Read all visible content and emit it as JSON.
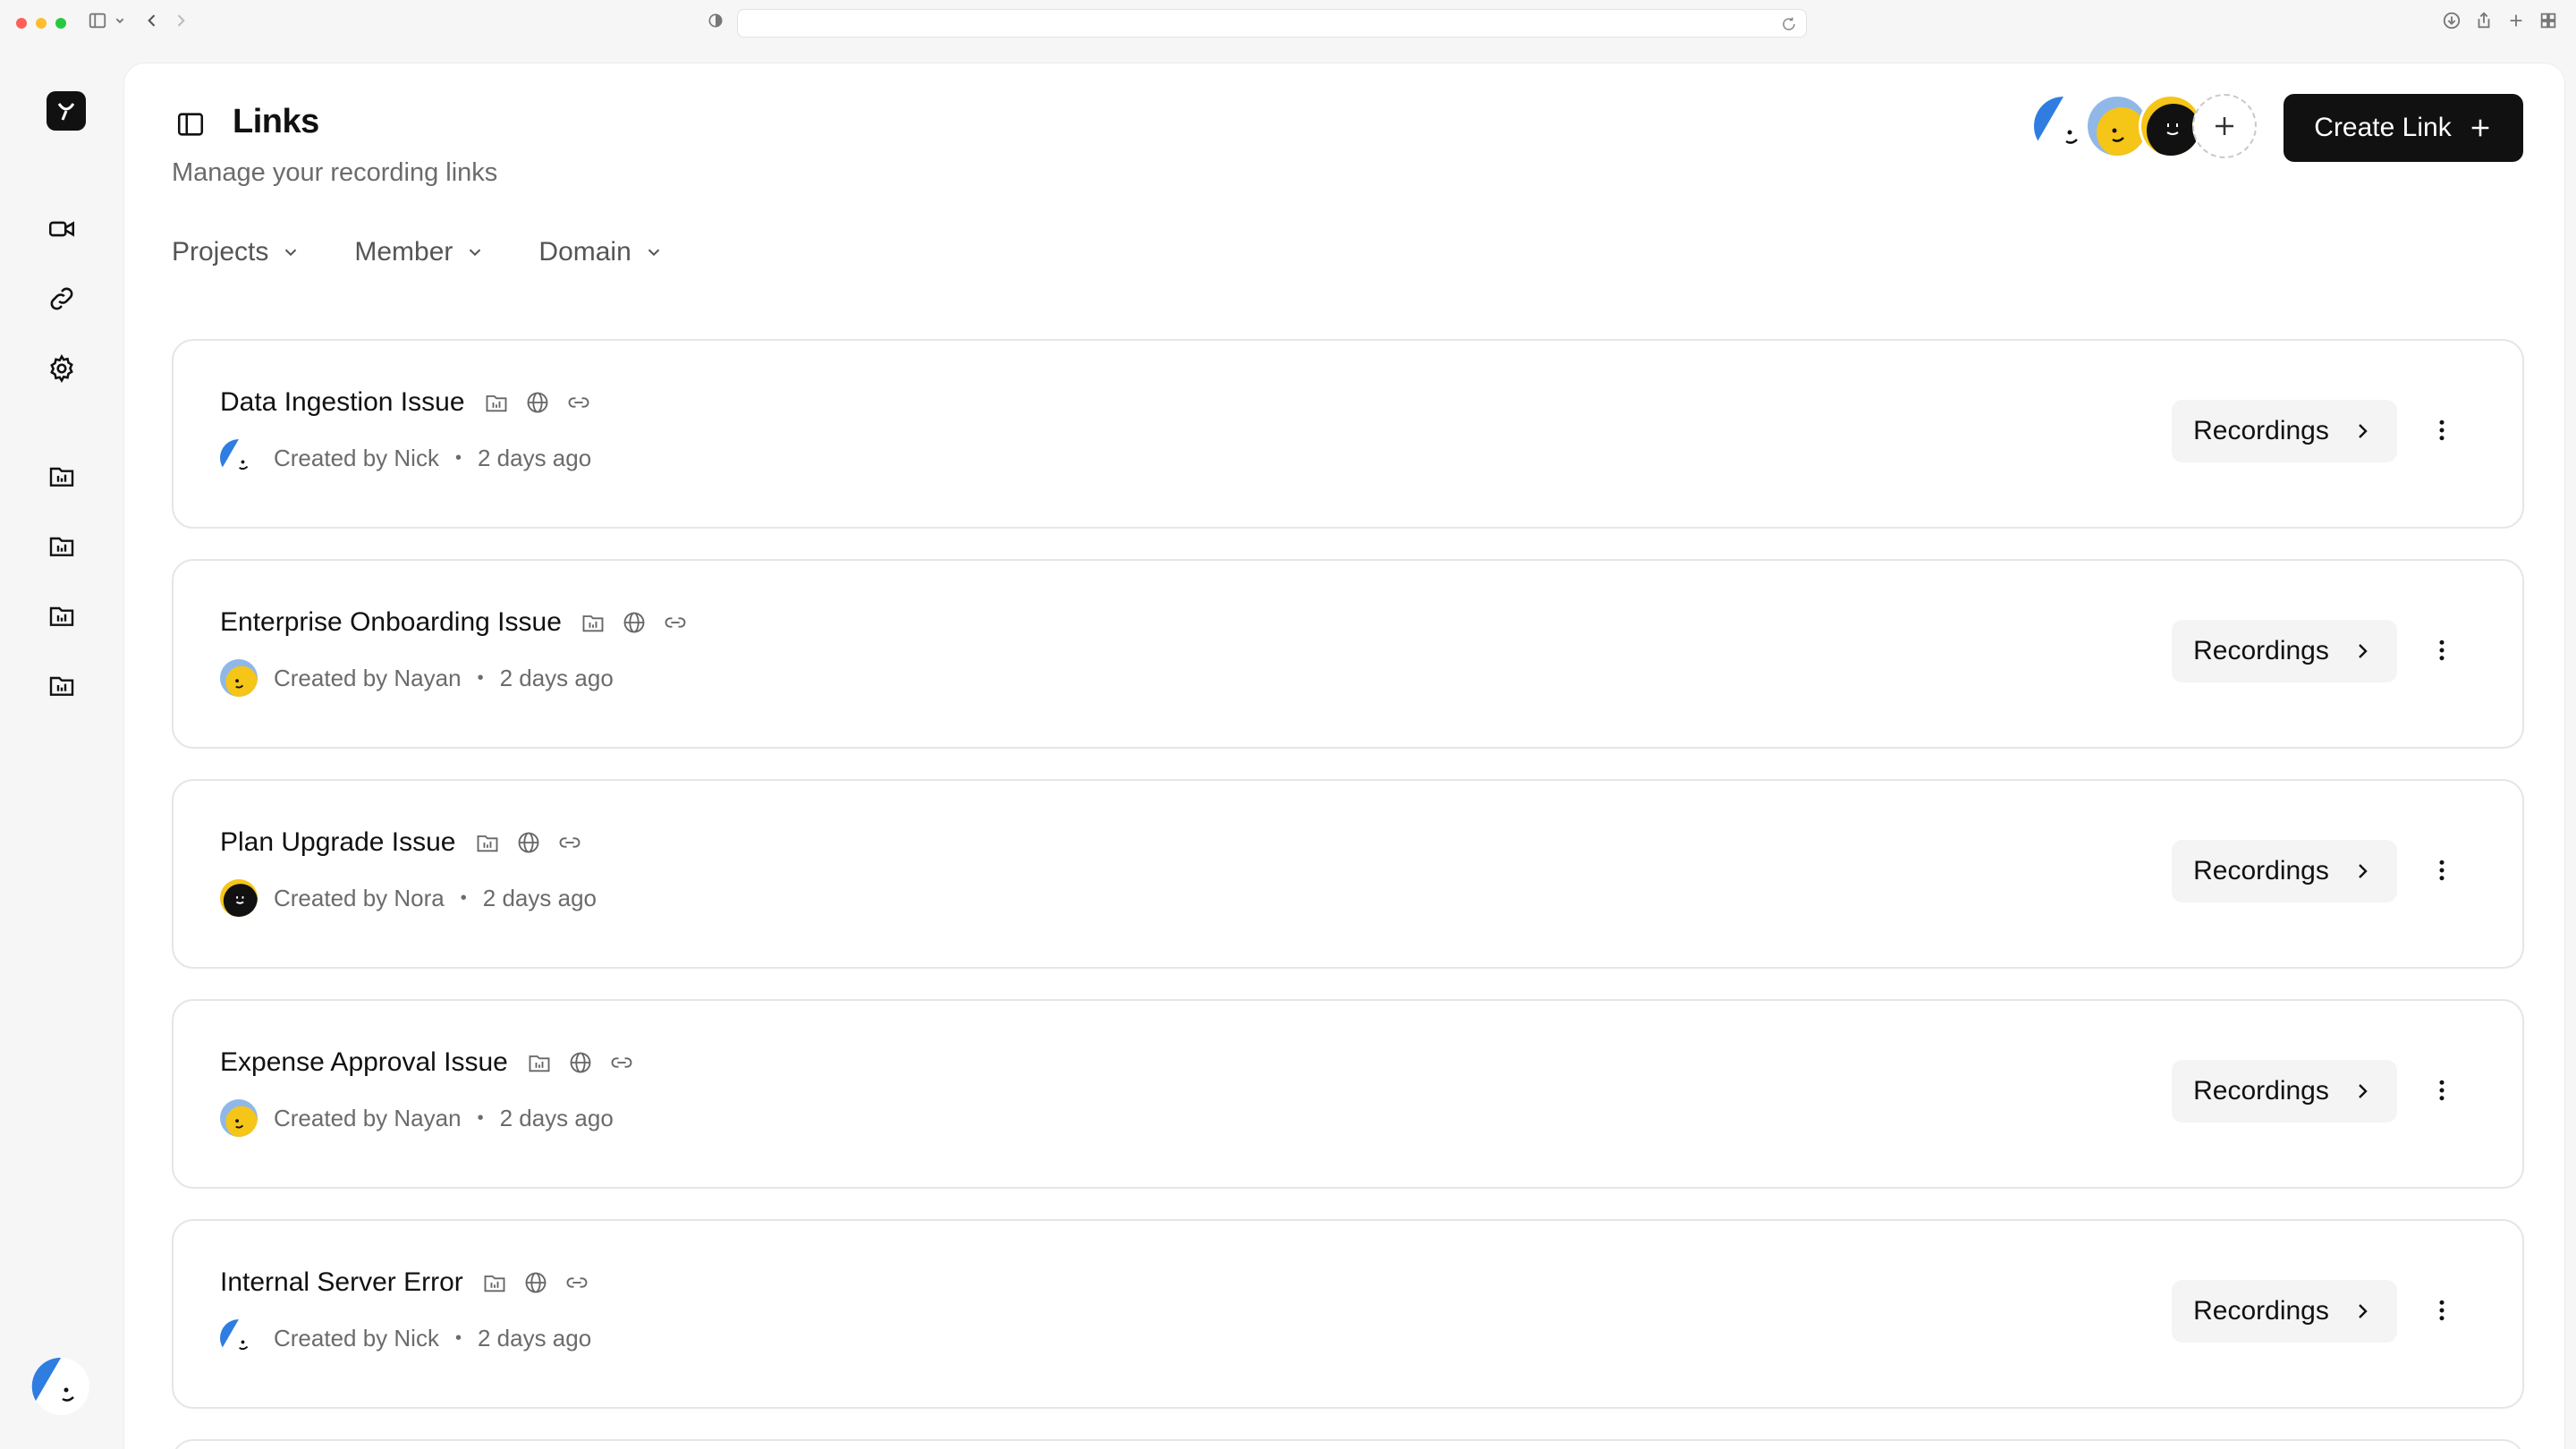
{
  "page": {
    "title": "Links",
    "subtitle": "Manage your recording links"
  },
  "filters": [
    {
      "label": "Projects"
    },
    {
      "label": "Member"
    },
    {
      "label": "Domain"
    }
  ],
  "actions": {
    "create_label": "Create Link"
  },
  "colors": {
    "accent": "#111111",
    "avatar_blue": "#2f7de1",
    "avatar_yellow": "#f5c518"
  },
  "links": [
    {
      "title": "Data Ingestion Issue",
      "created_by": "Created by Nick",
      "time": "2 days ago",
      "avatar": "blue",
      "button": "Recordings"
    },
    {
      "title": "Enterprise Onboarding Issue",
      "created_by": "Created by Nayan",
      "time": "2 days ago",
      "avatar": "yellow",
      "button": "Recordings"
    },
    {
      "title": "Plan Upgrade Issue",
      "created_by": "Created by Nora",
      "time": "2 days ago",
      "avatar": "black",
      "button": "Recordings"
    },
    {
      "title": "Expense Approval Issue",
      "created_by": "Created by Nayan",
      "time": "2 days ago",
      "avatar": "yellow",
      "button": "Recordings"
    },
    {
      "title": "Internal Server Error",
      "created_by": "Created by Nick",
      "time": "2 days ago",
      "avatar": "blue",
      "button": "Recordings"
    }
  ],
  "dot_separator": "•"
}
